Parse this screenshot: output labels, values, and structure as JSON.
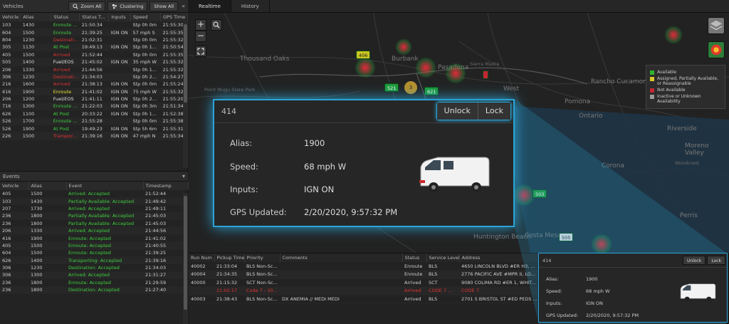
{
  "vehicles_panel": {
    "title": "Vehicles",
    "zoom_all": "Zoom All",
    "clustering": "Clustering",
    "show_all": "Show All",
    "collapse": "«",
    "columns": [
      "Vehicle",
      "Alias",
      "Status",
      "Status T...",
      "Inputs",
      "Speed",
      "GPS Time"
    ],
    "rows": [
      [
        "103",
        "1430",
        "Enroute ...",
        "21:50:34",
        "",
        "Stp 0h 0m",
        "21:55:30",
        "green"
      ],
      [
        "604",
        "1500",
        "Enroute",
        "21:39:25",
        "IGN ON",
        "57 mph S",
        "21:55:35",
        "green"
      ],
      [
        "804",
        "1230",
        "Destinati...",
        "21:02:31",
        "",
        "Stp 0h 0m",
        "21:55:32",
        "red"
      ],
      [
        "305",
        "1130",
        "At Post",
        "19:49:13",
        "IGN ON",
        "Stp 0h 1...",
        "21:50:54",
        "green"
      ],
      [
        "405",
        "1500",
        "Arrived",
        "21:52:44",
        "",
        "Stp 0h 0m",
        "21:55:35",
        "red"
      ],
      [
        "505",
        "1400",
        "Fuel/EOS",
        "21:45:02",
        "IGN ON",
        "35 mph W",
        "21:55:32",
        "white"
      ],
      [
        "206",
        "1330",
        "Arrived",
        "21:44:56",
        "",
        "Stp 0h 1...",
        "21:55:32",
        "red"
      ],
      [
        "306",
        "1230",
        "Destinati...",
        "21:34:03",
        "",
        "Stp 0h 2...",
        "21:54:27",
        "red"
      ],
      [
        "216",
        "1600",
        "Arrived",
        "21:38:13",
        "IGN ON",
        "Stp 0h 0m",
        "21:55:24",
        "red"
      ],
      [
        "416",
        "1900",
        "Enroute",
        "21:41:02",
        "IGN ON",
        "75 mph W",
        "21:55:32",
        "yellow"
      ],
      [
        "206",
        "1200",
        "Fuel/EOS",
        "21:41:11",
        "IGN ON",
        "Stp 0h 2...",
        "21:55:20",
        "white"
      ],
      [
        "716",
        "1300",
        "Enroute ...",
        "21:22:03",
        "IGN ON",
        "Stp 0h 3m",
        "21:51:34",
        "green"
      ],
      [
        "626",
        "1100",
        "At Post",
        "20:33:22",
        "IGN ON",
        "Stp 0h 1...",
        "21:52:38",
        "green"
      ],
      [
        "526",
        "1700",
        "Enroute ...",
        "21:55:28",
        "",
        "Stp 0h 0m",
        "21:55:38",
        "green"
      ],
      [
        "526",
        "1900",
        "At Post",
        "19:49:23",
        "IGN ON",
        "Stp 5h 6m",
        "21:55:31",
        "green"
      ],
      [
        "226",
        "1500",
        "Transpor...",
        "21:39:16",
        "IGN ON",
        "47 mph N",
        "21:55:34",
        "red"
      ]
    ]
  },
  "events_panel": {
    "title": "Events",
    "collapse": "▾",
    "columns": [
      "Vehicle",
      "Alias",
      "Event",
      "Timestamp"
    ],
    "rows": [
      [
        "405",
        "1500",
        "Arrived: Accepted",
        "21:52:44"
      ],
      [
        "103",
        "1430",
        "Partially Available: Accepted",
        "21:49:42"
      ],
      [
        "207",
        "1730",
        "Arrived: Accepted",
        "21:49:11"
      ],
      [
        "236",
        "1800",
        "Partially Available: Accepted",
        "21:45:03"
      ],
      [
        "236",
        "1800",
        "Partially Available: Accepted",
        "21:45:03"
      ],
      [
        "206",
        "1330",
        "Arrived: Accepted",
        "21:44:56"
      ],
      [
        "416",
        "1900",
        "Enroute: Accepted",
        "21:41:02"
      ],
      [
        "405",
        "1500",
        "Enroute: Accepted",
        "21:40:55"
      ],
      [
        "604",
        "1500",
        "Enroute: Accepted",
        "21:39:25"
      ],
      [
        "626",
        "1400",
        "Transporting: Accepted",
        "21:39:16"
      ],
      [
        "306",
        "1230",
        "Destination: Accepted",
        "21:34:03"
      ],
      [
        "306",
        "1300",
        "Arrived: Accepted",
        "21:31:27"
      ],
      [
        "236",
        "1800",
        "Enroute: Accepted",
        "21:29:59"
      ],
      [
        "236",
        "1800",
        "Destination: Accepted",
        "21:27:40"
      ]
    ]
  },
  "tabs": [
    "Realtime",
    "History"
  ],
  "map": {
    "cities": [
      {
        "name": "Thousand Oaks",
        "cls": ""
      },
      {
        "name": "Burbank",
        "cls": ""
      },
      {
        "name": "Pasadena",
        "cls": ""
      },
      {
        "name": "Sierra Madre",
        "cls": "small"
      },
      {
        "name": "West",
        "cls": ""
      },
      {
        "name": "Rancho Cucamonga",
        "cls": ""
      },
      {
        "name": "Pomona",
        "cls": ""
      },
      {
        "name": "Ontario",
        "cls": ""
      },
      {
        "name": "Riverside",
        "cls": ""
      },
      {
        "name": "Moreno Valley",
        "cls": ""
      },
      {
        "name": "Corona",
        "cls": ""
      },
      {
        "name": "Huntington Beach",
        "cls": ""
      },
      {
        "name": "Costa Mesa",
        "cls": ""
      },
      {
        "name": "Woodcrest",
        "cls": "small"
      },
      {
        "name": "Perris",
        "cls": ""
      },
      {
        "name": "Point Mugu State Park",
        "cls": "small"
      }
    ],
    "markers": [
      {
        "label": "406",
        "cls": "yellow"
      },
      {
        "label": "521",
        "cls": ""
      },
      {
        "label": "621",
        "cls": ""
      },
      {
        "label": "3",
        "cls": "cluster"
      },
      {
        "label": "503",
        "cls": ""
      },
      {
        "label": "505",
        "cls": "white"
      }
    ],
    "legend": [
      {
        "color": "#2fb52f",
        "label": "Available"
      },
      {
        "color": "#d6c82a",
        "label": "Assigned, Partially Available, or Reassignable"
      },
      {
        "color": "#c42634",
        "label": "Not Available"
      },
      {
        "color": "#9a9a9a",
        "label": "Inactive or Unknown Availability"
      }
    ]
  },
  "popup": {
    "title": "414",
    "unlock": "Unlock",
    "lock": "Lock",
    "fields": [
      {
        "label": "Alias:",
        "value": "1900"
      },
      {
        "label": "Speed:",
        "value": "68 mph W"
      },
      {
        "label": "Inputs:",
        "value": "IGN ON"
      },
      {
        "label": "GPS Updated:",
        "value": "2/20/2020, 9:57:32 PM"
      }
    ]
  },
  "runs": {
    "columns": [
      "Run Num",
      "Pickup Time",
      "Priority",
      "Comments",
      "Status",
      "Service Level",
      "Address"
    ],
    "rows": [
      [
        "40002",
        "21:33:04",
        "BLS Non-Sc...",
        "",
        "Enroute",
        "BLS",
        "4650 LINCOLN BLVD #ER H3, ...",
        "white"
      ],
      [
        "40004",
        "21:34:35",
        "BLS Non-Sc...",
        "",
        "Enroute",
        "BLS",
        "2776 PACIFIC AVE #MPR II, LO...",
        "white"
      ],
      [
        "40000",
        "21:15:32",
        "SCT Non-Sc...",
        "",
        "Arrived",
        "SCT",
        "9080 COLIMA RD #ER 1, WHIT...",
        "white"
      ],
      [
        "",
        "21:02:17",
        "Code 7 - 30...",
        "",
        "Arrived",
        "CODE 7 ...",
        "CODE 7",
        "red"
      ],
      [
        "40003",
        "21:38:43",
        "BLS Non-Sc...",
        "DX ANEMIA // MEDI MEDI",
        "Arrived",
        "BLS",
        "2701 S BRISTOL ST #ED PEDS ...",
        "white"
      ]
    ]
  },
  "mini_popup": {
    "title": "414",
    "unlock": "Unlock",
    "lock": "Lock",
    "fields": [
      {
        "label": "Alias:",
        "value": "1900"
      },
      {
        "label": "Speed:",
        "value": "68 mph W"
      },
      {
        "label": "Inputs:",
        "value": "IGN ON"
      },
      {
        "label": "GPS Updated:",
        "value": "2/20/2020, 9:57:32 PM"
      }
    ]
  }
}
